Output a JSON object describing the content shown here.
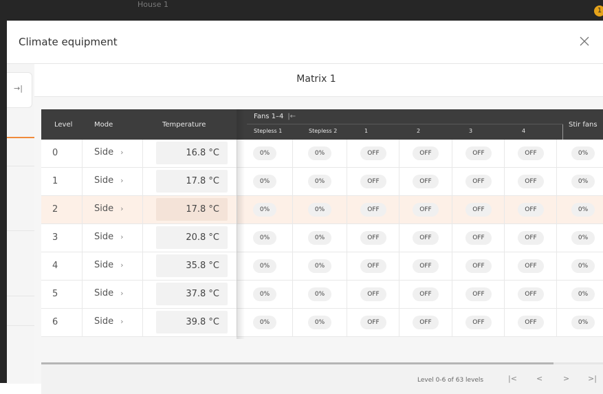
{
  "background": {
    "title": "House 1",
    "badge": "1"
  },
  "dialog": {
    "title": "Climate equipment",
    "close_icon": "close-icon",
    "expand_icon": "expand-panel-icon"
  },
  "matrix": {
    "title": "Matrix 1",
    "headers": {
      "level": "Level",
      "mode": "Mode",
      "temperature": "Temperature",
      "fans_group": "Fans 1–4",
      "fans_group_icon": "collapse-left-icon",
      "stepless1": "Stepless 1",
      "stepless2": "Stepless 2",
      "f1": "1",
      "f2": "2",
      "f3": "3",
      "f4": "4",
      "stir": "Stir fans"
    },
    "rows": [
      {
        "level": "0",
        "mode": "Side",
        "temp": "16.8 °C",
        "s1": "0%",
        "s2": "0%",
        "f1": "OFF",
        "f2": "OFF",
        "f3": "OFF",
        "f4": "OFF",
        "stir": "0%"
      },
      {
        "level": "1",
        "mode": "Side",
        "temp": "17.8 °C",
        "s1": "0%",
        "s2": "0%",
        "f1": "OFF",
        "f2": "OFF",
        "f3": "OFF",
        "f4": "OFF",
        "stir": "0%"
      },
      {
        "level": "2",
        "mode": "Side",
        "temp": "17.8 °C",
        "s1": "0%",
        "s2": "0%",
        "f1": "OFF",
        "f2": "OFF",
        "f3": "OFF",
        "f4": "OFF",
        "stir": "0%",
        "highlighted": true
      },
      {
        "level": "3",
        "mode": "Side",
        "temp": "20.8 °C",
        "s1": "0%",
        "s2": "0%",
        "f1": "OFF",
        "f2": "OFF",
        "f3": "OFF",
        "f4": "OFF",
        "stir": "0%"
      },
      {
        "level": "4",
        "mode": "Side",
        "temp": "35.8 °C",
        "s1": "0%",
        "s2": "0%",
        "f1": "OFF",
        "f2": "OFF",
        "f3": "OFF",
        "f4": "OFF",
        "stir": "0%"
      },
      {
        "level": "5",
        "mode": "Side",
        "temp": "37.8 °C",
        "s1": "0%",
        "s2": "0%",
        "f1": "OFF",
        "f2": "OFF",
        "f3": "OFF",
        "f4": "OFF",
        "stir": "0%"
      },
      {
        "level": "6",
        "mode": "Side",
        "temp": "39.8 °C",
        "s1": "0%",
        "s2": "0%",
        "f1": "OFF",
        "f2": "OFF",
        "f3": "OFF",
        "f4": "OFF",
        "stir": "0%"
      }
    ],
    "pagination": {
      "text": "Level 0-6 of 63 levels",
      "first": "|<",
      "prev": "<",
      "next": ">",
      "last": ">|"
    }
  },
  "colors": {
    "header_bg": "#3d3d3d",
    "highlight_row": "#fdf0e7",
    "accent": "#f08a3a"
  }
}
